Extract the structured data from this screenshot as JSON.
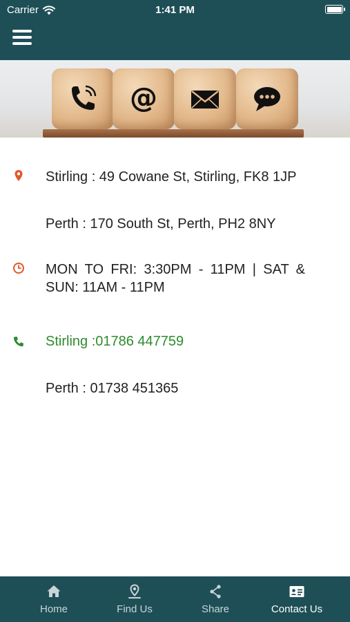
{
  "status_bar": {
    "carrier": "Carrier",
    "time": "1:41 PM"
  },
  "header": {
    "menu_icon": "hamburger-menu-icon"
  },
  "banner": {
    "icons": [
      "phone-icon",
      "at-sign-icon",
      "envelope-icon",
      "chat-bubble-icon"
    ]
  },
  "contact": {
    "address_stirling": "Stirling : 49 Cowane St, Stirling, FK8 1JP",
    "address_perth": "Perth : 170 South St, Perth, PH2 8NY",
    "hours": "MON TO FRI: 3:30PM - 11PM | SAT & SUN: 11AM - 11PM",
    "phone_stirling": "Stirling :01786 447759",
    "phone_perth": "Perth : 01738 451365"
  },
  "colors": {
    "header_bg": "#1e4f57",
    "icon_orange": "#e2572b",
    "phone_green": "#2e8b2e"
  },
  "nav": {
    "items": [
      {
        "label": "Home",
        "icon": "home-icon"
      },
      {
        "label": "Find Us",
        "icon": "location-pin-icon"
      },
      {
        "label": "Share",
        "icon": "share-icon"
      },
      {
        "label": "Contact Us",
        "icon": "contact-card-icon",
        "active": true
      }
    ]
  }
}
